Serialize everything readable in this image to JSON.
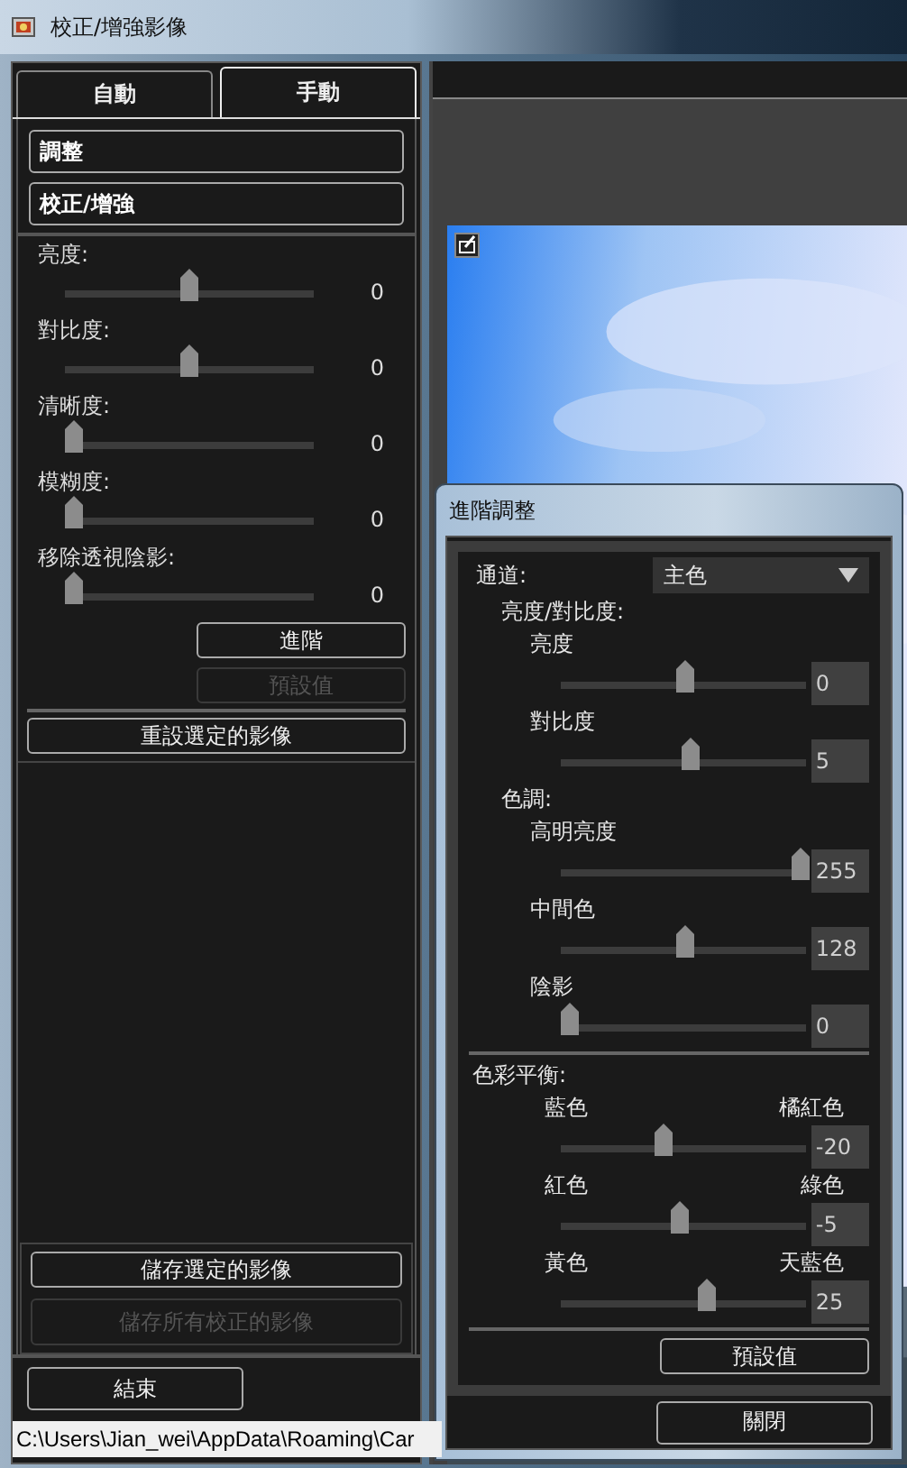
{
  "window": {
    "title": "校正/增強影像"
  },
  "tabs": [
    {
      "label": "自動",
      "selected": false
    },
    {
      "label": "手動",
      "selected": true
    }
  ],
  "sections": [
    "調整",
    "校正/增強"
  ],
  "sliders": [
    {
      "label": "亮度:",
      "level": 0.5,
      "reading": "0"
    },
    {
      "label": "對比度:",
      "level": 0.5,
      "reading": "0"
    },
    {
      "label": "清晰度:",
      "level": 0,
      "reading": "0"
    },
    {
      "label": "模糊度:",
      "level": 0,
      "reading": "0"
    },
    {
      "label": "移除透視陰影:",
      "level": 0,
      "reading": "0"
    }
  ],
  "buttons": [
    {
      "label": "進階",
      "disabled": false
    },
    {
      "label": "預設值",
      "disabled": true
    }
  ],
  "reset_button": "重設選定的影像",
  "save_buttons": [
    {
      "label": "儲存選定的影像",
      "disabled": false
    },
    {
      "label": "儲存所有校正的影像",
      "disabled": true
    }
  ],
  "exit_button": "結束",
  "status_bar": "C:\\Users\\Jian_wei\\AppData\\Roaming\\Car",
  "dialog": {
    "title": "進階調整",
    "channel": {
      "label": "通道:",
      "value": "主色"
    },
    "groups": [
      {
        "kind": "tone",
        "heading": "亮度/對比度:",
        "sliders": [
          {
            "label": "亮度",
            "level": 0.5,
            "value": "0"
          },
          {
            "label": "對比度",
            "level": 0.52,
            "value": "5"
          }
        ]
      },
      {
        "kind": "tone",
        "heading": "色調:",
        "sliders": [
          {
            "label": "高明亮度",
            "level": 1,
            "value": "255"
          },
          {
            "label": "中間色",
            "level": 0.5,
            "value": "128"
          },
          {
            "label": "陰影",
            "level": 0,
            "value": "0"
          }
        ]
      },
      {
        "kind": "balance",
        "heading": "色彩平衡:",
        "sliders": [
          {
            "left_label": "藍色",
            "right_label": "橘紅色",
            "level": 0.41,
            "value": "-20"
          },
          {
            "left_label": "紅色",
            "right_label": "綠色",
            "level": 0.48,
            "value": "-5"
          },
          {
            "left_label": "黃色",
            "right_label": "天藍色",
            "level": 0.59,
            "value": "25"
          }
        ]
      }
    ],
    "default_button": "預設值",
    "close_button": "關閉"
  }
}
